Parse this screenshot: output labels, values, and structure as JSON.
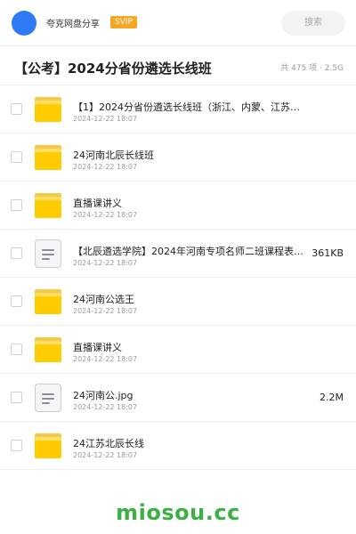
{
  "header": {
    "user_name": "夸克网盘分享",
    "badge": "SVIP",
    "search_placeholder": "搜索"
  },
  "share": {
    "title": "【公考】2024分省份遴选长线班",
    "meta": "共 475 项 · 2.5G"
  },
  "files": [
    {
      "type": "folder",
      "name": "【1】2024分省份遴选长线班（浙江、内蒙、江苏、…",
      "date": "2024-12-22 18:07",
      "size": ""
    },
    {
      "type": "folder",
      "name": "24河南北辰长线班",
      "date": "2024-12-22 18:07",
      "size": ""
    },
    {
      "type": "folder",
      "name": "直播课讲义",
      "date": "2024-12-22 18:07",
      "size": ""
    },
    {
      "type": "doc",
      "name": "【北辰遴选学院】2024年河南专项名师二班课程表(…",
      "date": "2024-12-22 18:07",
      "size": "361KB"
    },
    {
      "type": "folder",
      "name": "24河南公选王",
      "date": "2024-12-22 18:07",
      "size": ""
    },
    {
      "type": "folder",
      "name": "直播课讲义",
      "date": "2024-12-22 18:07",
      "size": ""
    },
    {
      "type": "doc",
      "name": "24河南公.jpg",
      "date": "2024-12-22 18:07",
      "size": "2.2M"
    },
    {
      "type": "folder",
      "name": "24江苏北辰长线",
      "date": "2024-12-22 18:07",
      "size": ""
    }
  ],
  "watermark": "miosou.cc",
  "colors": {
    "avatar": "#2f7bf5",
    "badge": "#f5a623",
    "folder": "#ffcc00",
    "watermark": "#3cb043"
  }
}
